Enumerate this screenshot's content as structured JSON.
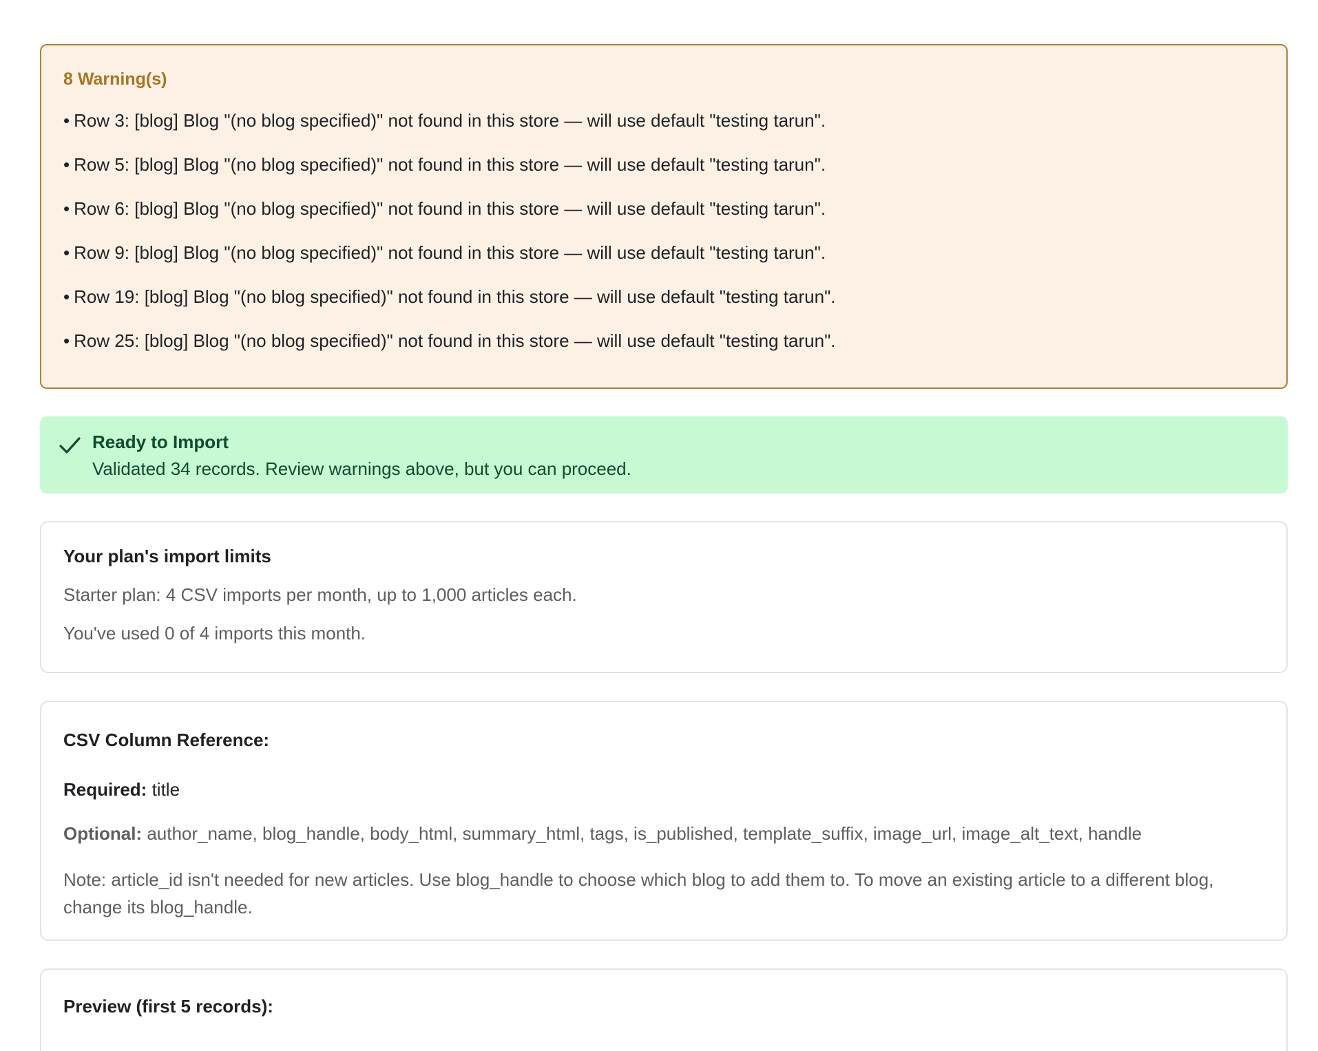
{
  "warnings": {
    "title": "8 Warning(s)",
    "bullet": "•",
    "items": [
      "Row 3: [blog] Blog \"(no blog specified)\" not found in this store — will use default \"testing tarun\".",
      "Row 5: [blog] Blog \"(no blog specified)\" not found in this store — will use default \"testing tarun\".",
      "Row 6: [blog] Blog \"(no blog specified)\" not found in this store — will use default \"testing tarun\".",
      "Row 9: [blog] Blog \"(no blog specified)\" not found in this store — will use default \"testing tarun\".",
      "Row 19: [blog] Blog \"(no blog specified)\" not found in this store — will use default \"testing tarun\".",
      "Row 25: [blog] Blog \"(no blog specified)\" not found in this store — will use default \"testing tarun\"."
    ]
  },
  "ready": {
    "icon": "checkmark-icon",
    "title": "Ready to Import",
    "message": "Validated 34 records. Review warnings above, but you can proceed."
  },
  "limits": {
    "heading": "Your plan's import limits",
    "plan_line": "Starter plan: 4 CSV imports per month, up to 1,000 articles each.",
    "usage_line": "You've used 0 of 4 imports this month."
  },
  "column_reference": {
    "heading": "CSV Column Reference:",
    "required_label": "Required:",
    "required_value": "title",
    "optional_label": "Optional:",
    "optional_value": "author_name, blog_handle, body_html, summary_html, tags, is_published, template_suffix, image_url, image_alt_text, handle",
    "note": "Note: article_id isn't needed for new articles. Use blog_handle to choose which blog to add them to. To move an existing article to a different blog, change its blog_handle."
  },
  "preview": {
    "heading": "Preview (first 5 records):"
  },
  "colors": {
    "warning_bg": "#fdf1e6",
    "warning_border": "#b0803a",
    "warning_title": "#a87522",
    "success_bg": "#c7f9d3",
    "success_text": "#0f4d31",
    "card_border": "#e1e3e5",
    "muted_text": "#5c5f62"
  }
}
